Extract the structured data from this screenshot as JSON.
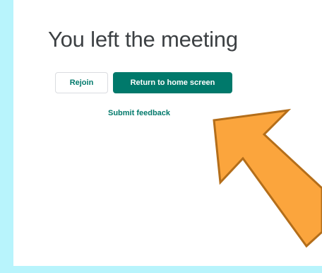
{
  "page": {
    "title": "You left the meeting"
  },
  "actions": {
    "rejoin_label": "Rejoin",
    "return_home_label": "Return to home screen",
    "feedback_label": "Submit feedback"
  },
  "colors": {
    "background_frame": "#b8f4fc",
    "accent": "#00796b",
    "arrow_fill": "#fba53d",
    "arrow_stroke": "#b46e1a"
  },
  "annotation": {
    "icon": "arrow-up-left-icon"
  }
}
